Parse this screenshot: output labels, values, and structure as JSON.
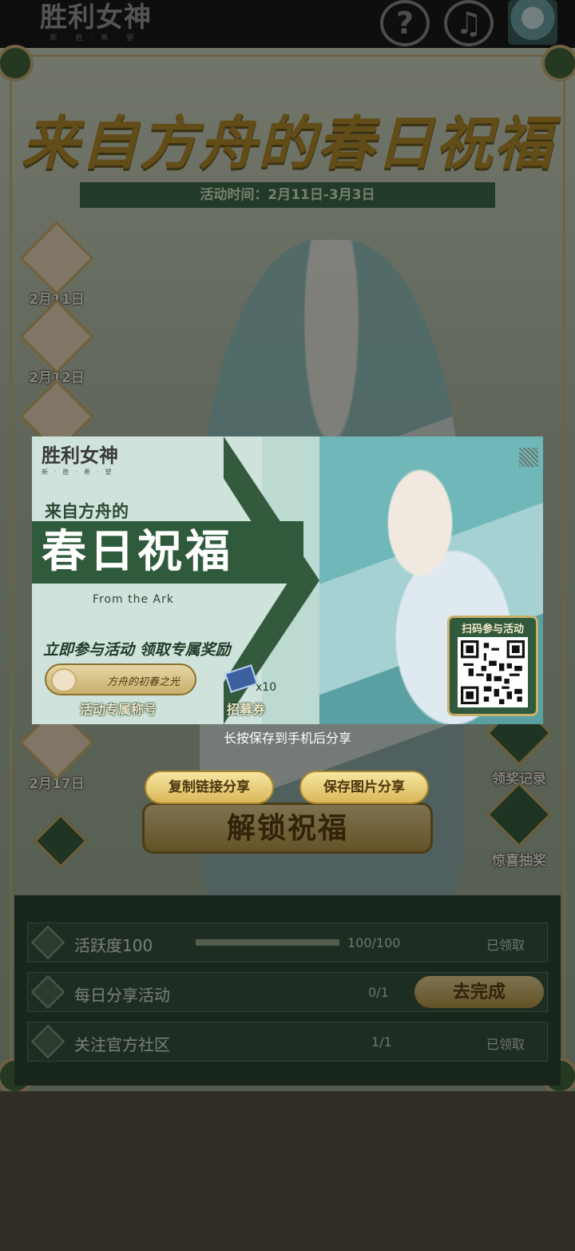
{
  "topbar": {
    "logo_title": "胜利女神",
    "logo_sub": "新·胜·希·望",
    "help_icon": "?",
    "music_icon": "♫"
  },
  "event": {
    "title": "来自方舟的春日祝福",
    "time": "活动时间：2月11日-3月3日"
  },
  "days": [
    {
      "label": "2月11日"
    },
    {
      "label": "2月12日"
    },
    {
      "label": "2月17日"
    }
  ],
  "side": {
    "records": "领奖记录",
    "lottery": "惊喜抽奖"
  },
  "unlock_label": "解锁祝福",
  "tasks": [
    {
      "name": "活跃度100",
      "progress": "100/100",
      "status": "已领取"
    },
    {
      "name": "每日分享活动",
      "progress": "0/1",
      "status": "去完成"
    },
    {
      "name": "关注官方社区",
      "progress": "1/1",
      "status": "已领取"
    }
  ],
  "card": {
    "logo_title": "胜利女神",
    "logo_sub": "新·胜·希·望",
    "subtitle": "来自方舟的",
    "big_title": "春日祝福",
    "english": "From the Ark",
    "call": "立即参与活动 领取专属奖励",
    "badge_text": "方舟的初春之光",
    "reward1": "活动专属称号",
    "reward2": "招募券",
    "reward2_qty": "x10",
    "qr_label": "扫码参与活动"
  },
  "hint": "长按保存到手机后分享",
  "buttons": {
    "copy": "复制链接分享",
    "save": "保存图片分享"
  },
  "colors": {
    "dark_green": "#2f5a3b",
    "gold": "#c9b06c"
  }
}
